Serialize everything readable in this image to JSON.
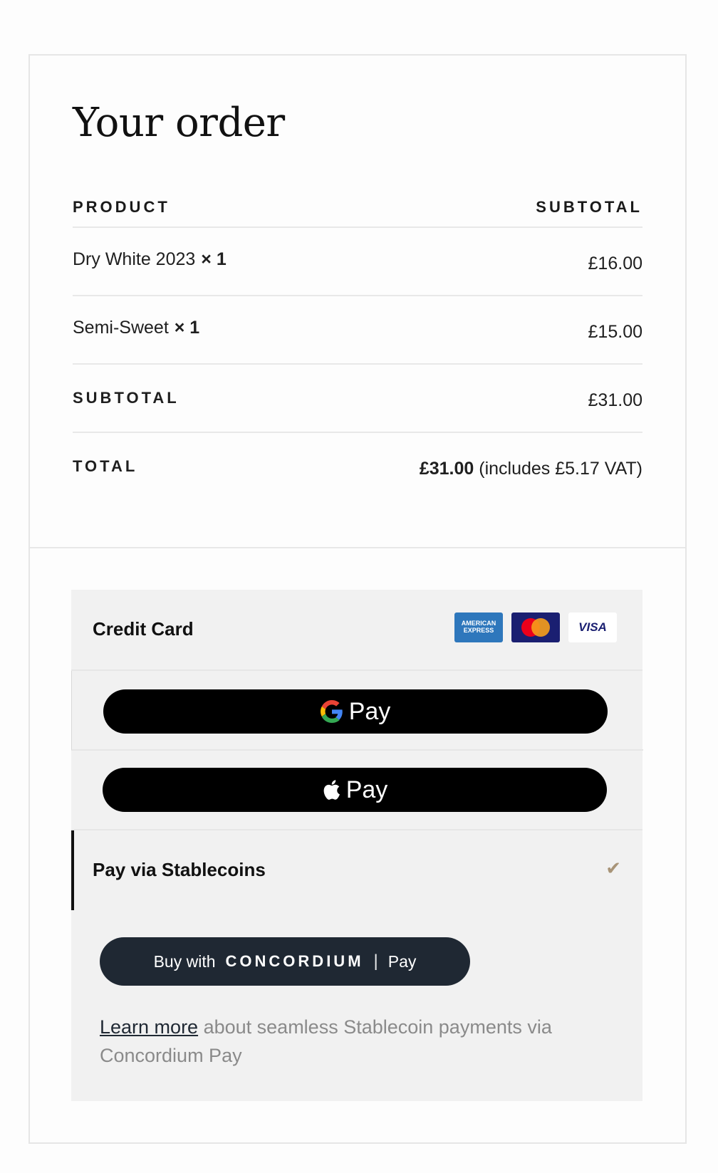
{
  "order": {
    "title": "Your order",
    "col_product": "PRODUCT",
    "col_subtotal": "SUBTOTAL",
    "items": [
      {
        "name": "Dry White 2023",
        "qty": "× 1",
        "price": "£16.00"
      },
      {
        "name": "Semi-Sweet",
        "qty": "× 1",
        "price": "£15.00"
      }
    ],
    "subtotal_label": "SUBTOTAL",
    "subtotal_value": "£31.00",
    "total_label": "TOTAL",
    "total_value": "£31.00",
    "total_note": "(includes £5.17 VAT)"
  },
  "payment": {
    "credit_card_label": "Credit Card",
    "card_logos": [
      "amex-logo",
      "mastercard-logo",
      "visa-logo"
    ],
    "amex_text": "AMERICAN EXPRESS",
    "visa_text": "VISA",
    "gpay_label": "Pay",
    "applepay_label": "Pay",
    "stablecoin_label": "Pay via Stablecoins",
    "concordium": {
      "prefix": "Buy with",
      "brand": "CONCORDIUM",
      "separator": "|",
      "suffix": "Pay"
    },
    "learn_more_link": "Learn more",
    "learn_more_text": "about seamless Stablecoin payments via Concordium Pay"
  },
  "colors": {
    "check": "#a89478",
    "concordium_button": "#1f2833",
    "panel_bg": "#f1f1f1"
  }
}
